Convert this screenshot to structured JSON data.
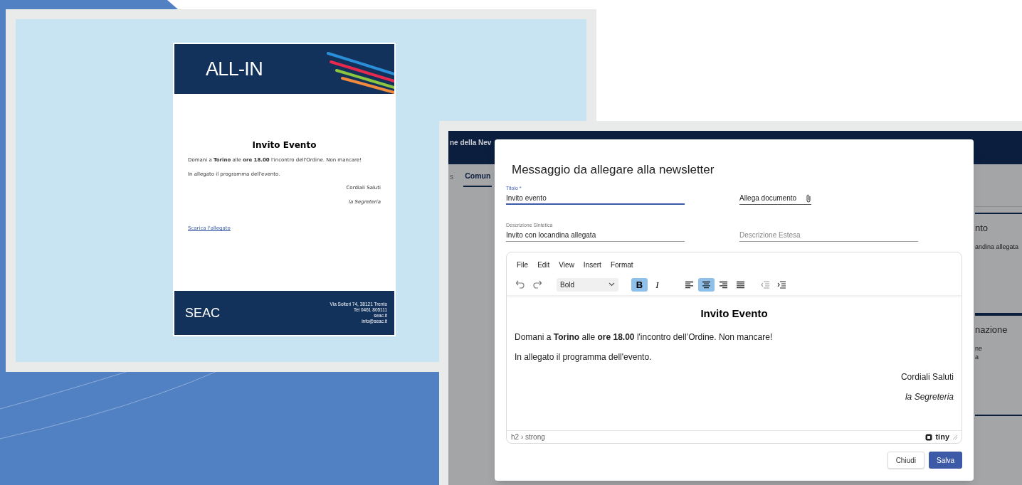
{
  "email_preview": {
    "brand": "ALL-IN",
    "heading": "Invito Evento",
    "paragraphs": [
      "Domani a **Torino** alle **ore 18.00** l'incontro dell'Ordine. Non mancare!",
      "In allegato il programma dell'evento."
    ],
    "closing": "Cordiali Saluti",
    "signature": "la Segreteria",
    "link": "Scarica l'allegato",
    "footer_brand": "SEAC",
    "footer_lines": [
      "Via Solteri 74, 38121 Trento",
      "Tel 0461 805111",
      "seac.it",
      "info@seac.it"
    ]
  },
  "background_app": {
    "header_title": "ne della Nev",
    "tabs": [
      {
        "label": "s",
        "selected": false
      },
      {
        "label": "Comun",
        "selected": true
      }
    ],
    "cards": [
      {
        "title": "nto",
        "lines": [
          "andina allegata"
        ]
      },
      {
        "title": "nazione",
        "lines": [
          "ne",
          "a"
        ]
      }
    ]
  },
  "dialog": {
    "title": "Messaggio da allegare alla newsletter",
    "fields": [
      {
        "kind": "text",
        "label": "Titolo *",
        "value": "Invito evento",
        "focused": true
      },
      {
        "kind": "file",
        "placeholder": "Allega documento"
      },
      {
        "kind": "text",
        "label": "Descrizione Sintetica",
        "value": "Invito con locandina allegata",
        "focused": false
      },
      {
        "kind": "text",
        "placeholder": "Descrizione Estesa",
        "focused": false
      }
    ],
    "editor": {
      "menu": [
        "File",
        "Edit",
        "View",
        "Insert",
        "Format"
      ],
      "block_format": "Bold",
      "format_buttons": [
        {
          "label": "B",
          "kind": "bold",
          "selected": true
        },
        {
          "label": "I",
          "kind": "italic",
          "selected": false
        }
      ],
      "align_buttons": [
        {
          "kind": "left",
          "selected": false
        },
        {
          "kind": "center",
          "selected": true
        },
        {
          "kind": "right",
          "selected": false
        },
        {
          "kind": "justify",
          "selected": false
        }
      ],
      "heading": "Invito Evento",
      "paragraphs": [
        "Domani a **Torino** alle **ore 18.00** l'incontro dell’Ordine. Non mancare!",
        "In allegato il programma dell'evento."
      ],
      "closing": "Cordiali Saluti",
      "signature": "la Segreteria",
      "path": "h2 › strong",
      "brand": "tiny"
    },
    "buttons": [
      {
        "label": "Chiudi",
        "kind": "secondary"
      },
      {
        "label": "Salva",
        "kind": "primary"
      }
    ]
  }
}
